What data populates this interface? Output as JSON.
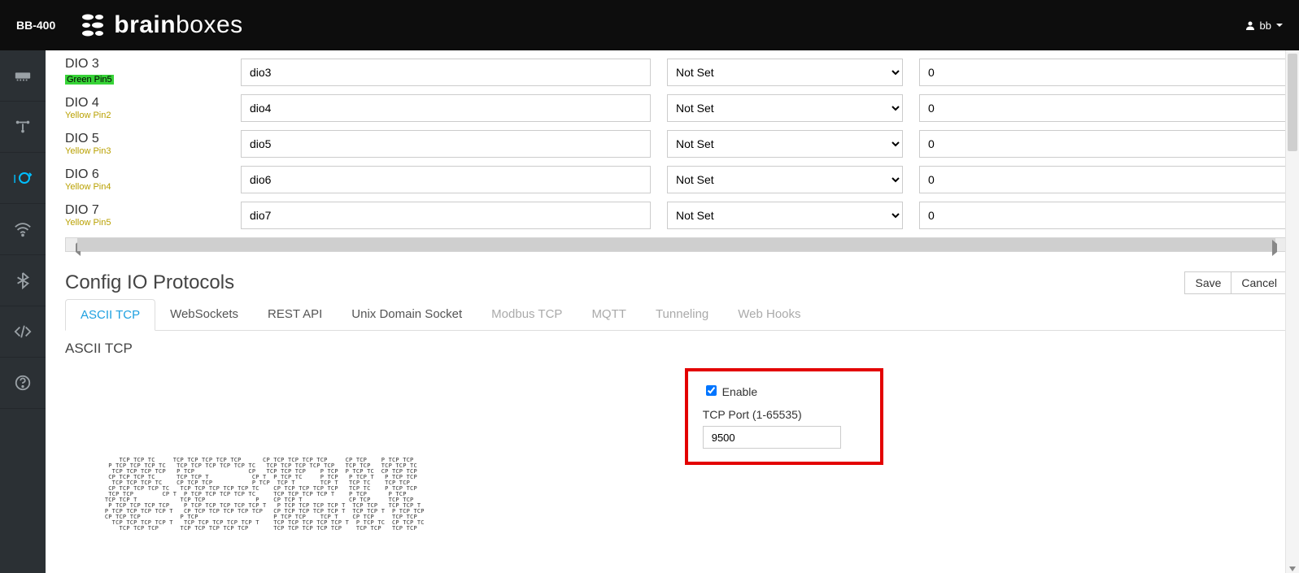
{
  "header": {
    "product": "BB-400",
    "brand_a": "brain",
    "brand_b": "boxes",
    "user": "bb"
  },
  "dio": [
    {
      "title": "DIO 3",
      "sub": "Green Pin5",
      "sub_style": "green",
      "name": "dio3",
      "mode": "Not Set",
      "count": "0"
    },
    {
      "title": "DIO 4",
      "sub": "Yellow Pin2",
      "sub_style": "yellow",
      "name": "dio4",
      "mode": "Not Set",
      "count": "0"
    },
    {
      "title": "DIO 5",
      "sub": "Yellow Pin3",
      "sub_style": "yellow",
      "name": "dio5",
      "mode": "Not Set",
      "count": "0"
    },
    {
      "title": "DIO 6",
      "sub": "Yellow Pin4",
      "sub_style": "yellow",
      "name": "dio6",
      "mode": "Not Set",
      "count": "0"
    },
    {
      "title": "DIO 7",
      "sub": "Yellow Pin5",
      "sub_style": "yellow",
      "name": "dio7",
      "mode": "Not Set",
      "count": "0"
    }
  ],
  "section": {
    "title": "Config IO Protocols",
    "save": "Save",
    "cancel": "Cancel"
  },
  "tabs": [
    "ASCII TCP",
    "WebSockets",
    "REST API",
    "Unix Domain Socket",
    "Modbus TCP",
    "MQTT",
    "Tunneling",
    "Web Hooks"
  ],
  "subsection_title": "ASCII TCP",
  "enable": {
    "label": "Enable",
    "checked": true,
    "port_label": "TCP Port (1-65535)",
    "port_value": "9500"
  }
}
